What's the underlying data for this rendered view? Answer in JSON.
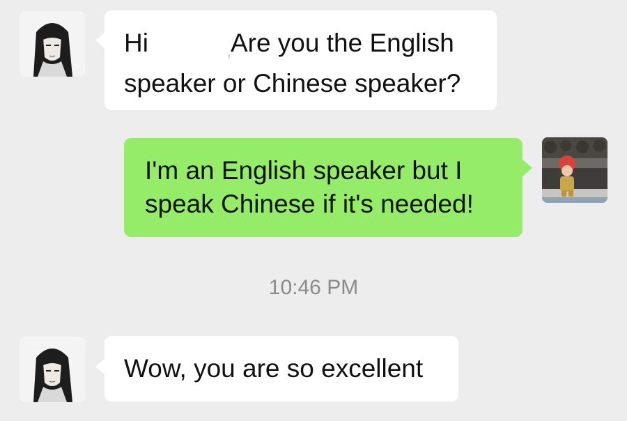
{
  "messages": [
    {
      "sender": "contact",
      "text_before_redaction": "Hi",
      "redaction_mark": ",",
      "text_after_redaction": "Are you the English",
      "line2": "speaker or Chinese speaker?"
    },
    {
      "sender": "me",
      "line1": "I'm an English speaker but I",
      "line2": "speak Chinese if it's needed!"
    },
    {
      "sender": "contact",
      "line1": "Wow, you are so excellent"
    }
  ],
  "timestamp": "10:46 PM",
  "colors": {
    "background": "#ededed",
    "incoming_bubble": "#ffffff",
    "outgoing_bubble": "#95ec69",
    "timestamp_text": "#8a8a8a"
  },
  "icons": {
    "contact_avatar": "anime-character-avatar-icon",
    "my_avatar": "figurine-photo-avatar-icon"
  }
}
